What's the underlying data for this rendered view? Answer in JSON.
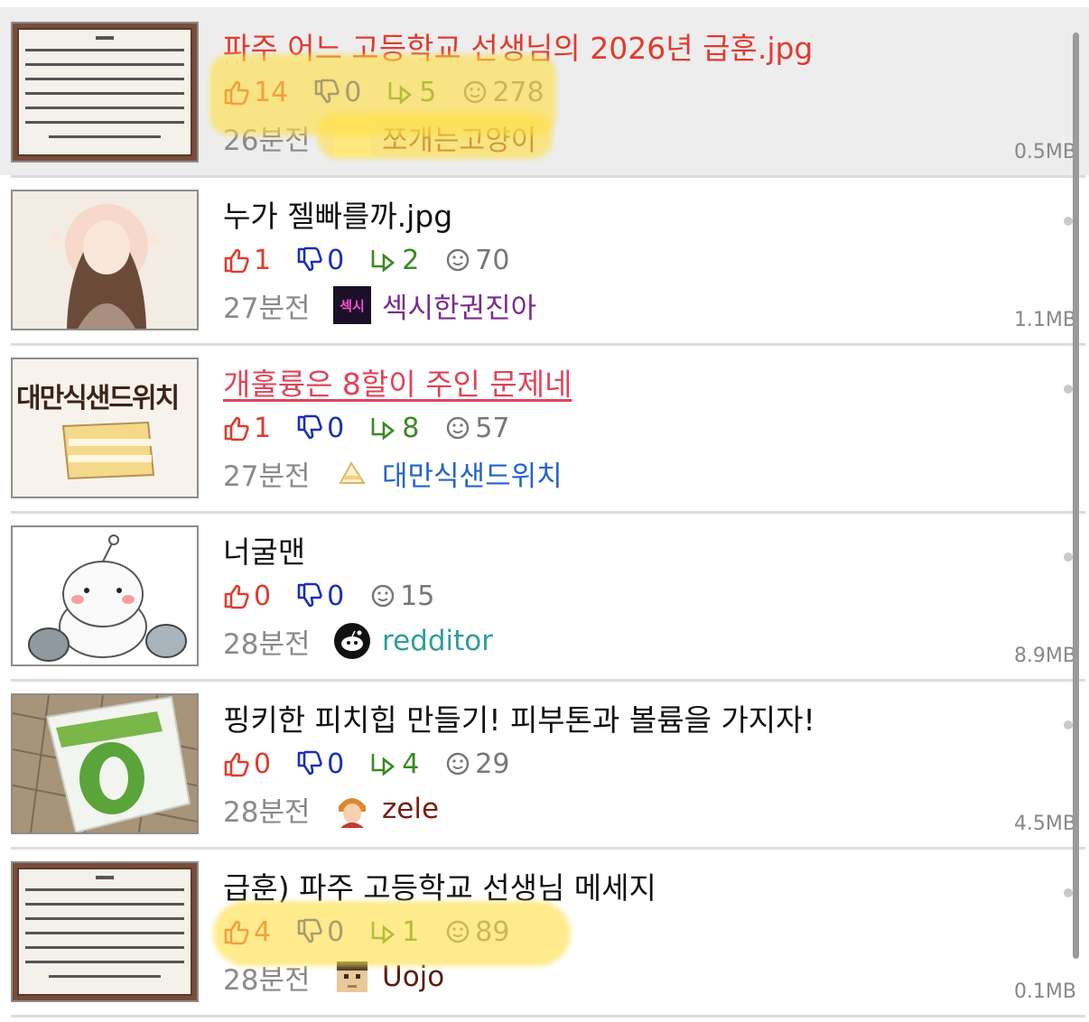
{
  "posts": [
    {
      "title": "파주 어느 고등학교 선생님의 2026년 급훈.jpg",
      "up": "14",
      "down": "0",
      "reply": "5",
      "views": "278",
      "time": "26분전",
      "author": "쪼개는고양이",
      "size": "0.5MB"
    },
    {
      "title": "누가 젤빠를까.jpg",
      "up": "1",
      "down": "0",
      "reply": "2",
      "views": "70",
      "time": "27분전",
      "author": "섹시한권진아",
      "size": "1.1MB",
      "avatar_text": "섹시"
    },
    {
      "title": "개훌륭은 8할이 주인 문제네",
      "up": "1",
      "down": "0",
      "reply": "8",
      "views": "57",
      "time": "27분전",
      "author": "대만식샌드위치",
      "size": "",
      "thumb_text": "대만식샌드위치"
    },
    {
      "title": "너굴맨",
      "up": "0",
      "down": "0",
      "views": "15",
      "time": "28분전",
      "author": "redditor",
      "size": "8.9MB"
    },
    {
      "title": "핑키한 피치힙 만들기! 피부톤과 볼륨을 가지자!",
      "up": "0",
      "down": "0",
      "reply": "4",
      "views": "29",
      "time": "28분전",
      "author": "zele",
      "size": "4.5MB"
    },
    {
      "title": "급훈) 파주 고등학교 선생님 메세지",
      "up": "4",
      "down": "0",
      "reply": "1",
      "views": "89",
      "time": "28분전",
      "author": "Uojo",
      "size": "0.1MB"
    }
  ],
  "colors": {
    "highlight": "#ffdf46",
    "up": "#e03b2f",
    "down": "#1a2fb8",
    "reply": "#3a8a22"
  }
}
